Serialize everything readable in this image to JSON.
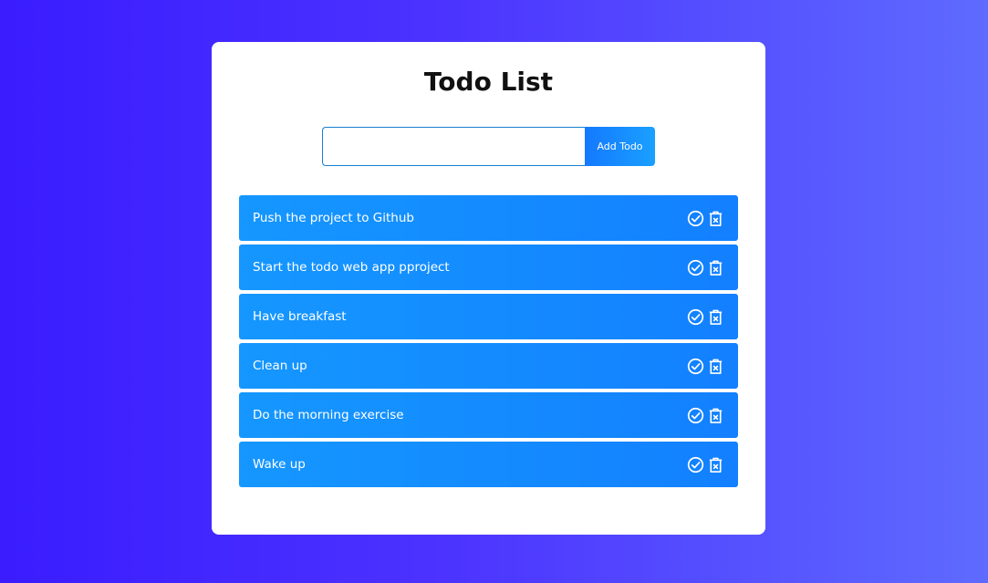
{
  "app": {
    "title": "Todo List"
  },
  "form": {
    "input_value": "",
    "add_label": "Add Todo"
  },
  "todos": [
    {
      "text": "Push the project to Github"
    },
    {
      "text": "Start the todo web app pproject"
    },
    {
      "text": "Have breakfast"
    },
    {
      "text": "Clean up"
    },
    {
      "text": "Do the morning exercise"
    },
    {
      "text": "Wake up"
    }
  ],
  "icons": {
    "complete": "check-circle-icon",
    "delete": "trash-icon"
  },
  "colors": {
    "background_start": "#3a1cff",
    "background_end": "#5e6bff",
    "item": "#1597ff",
    "button": "#1479ff"
  }
}
